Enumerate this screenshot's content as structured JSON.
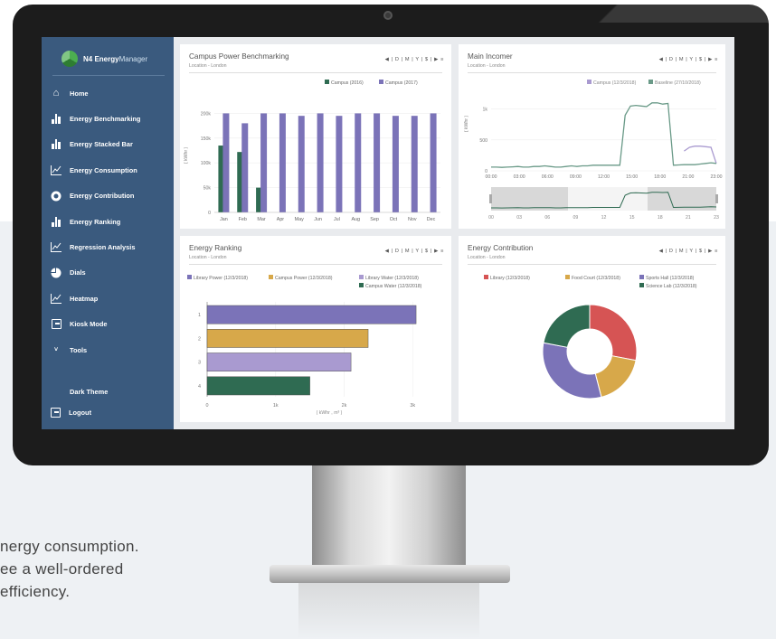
{
  "caption": {
    "line1": "nergy consumption.",
    "line2": "ee a well-ordered",
    "line3": " efficiency."
  },
  "app": {
    "brand_bold": "N4 Energy",
    "brand_light": "Manager"
  },
  "sidebar": {
    "items": [
      {
        "label": "Home",
        "icon": "home-icon"
      },
      {
        "label": "Energy Benchmarking",
        "icon": "bar-chart-icon"
      },
      {
        "label": "Energy Stacked Bar",
        "icon": "bar-chart-icon"
      },
      {
        "label": "Energy Consumption",
        "icon": "line-chart-icon"
      },
      {
        "label": "Energy Contribution",
        "icon": "donut-icon"
      },
      {
        "label": "Energy Ranking",
        "icon": "bar-chart-icon"
      },
      {
        "label": "Regression Analysis",
        "icon": "line-chart-icon"
      },
      {
        "label": "Dials",
        "icon": "pie-icon"
      },
      {
        "label": "Heatmap",
        "icon": "line-chart-icon"
      },
      {
        "label": "Kiosk Mode",
        "icon": "kiosk-icon"
      },
      {
        "label": "Tools",
        "icon": "chevron-down-icon"
      }
    ],
    "theme_label": "Dark Theme",
    "logout_label": "Logout"
  },
  "controls": "◀ | D | M | Y | $ | ▶  ≡",
  "colors": {
    "sidebar": "#3a5a7e",
    "purple": "#7b73b8",
    "green": "#2f6b52",
    "gold": "#d7a84a",
    "red": "#d65454",
    "lavender": "#a99ad0"
  },
  "panels": {
    "benchmark": {
      "title": "Campus Power Benchmarking",
      "subtitle": "Location - London"
    },
    "incomer": {
      "title": "Main Incomer",
      "subtitle": "Location - London"
    },
    "ranking": {
      "title": "Energy Ranking",
      "subtitle": "Location - London"
    },
    "contribution": {
      "title": "Energy Contribution",
      "subtitle": "Location - London"
    }
  },
  "chart_data": [
    {
      "id": "benchmark",
      "type": "bar",
      "title": "Campus Power Benchmarking",
      "ylabel": "( kWhr )",
      "categories": [
        "Jan",
        "Feb",
        "Mar",
        "Apr",
        "May",
        "Jun",
        "Jul",
        "Aug",
        "Sep",
        "Oct",
        "Nov",
        "Dec"
      ],
      "yticks": [
        "0",
        "50k",
        "100k",
        "150k",
        "200k"
      ],
      "ylim": [
        0,
        230000
      ],
      "series": [
        {
          "name": "Campus (2016)",
          "color": "#2f6b52",
          "values": [
            135000,
            122000,
            50000,
            null,
            null,
            null,
            null,
            null,
            null,
            null,
            null,
            null
          ]
        },
        {
          "name": "Campus (2017)",
          "color": "#7b73b8",
          "values": [
            200000,
            180000,
            200000,
            200000,
            195000,
            200000,
            195000,
            200000,
            200000,
            195000,
            195000,
            200000
          ]
        }
      ]
    },
    {
      "id": "incomer",
      "type": "line",
      "title": "Main Incomer",
      "ylabel": "( kWhr )",
      "x": [
        "00:00",
        "03:00",
        "06:00",
        "09:00",
        "12:00",
        "15:00",
        "18:00",
        "21:00",
        "23:00"
      ],
      "yticks": [
        "0",
        "500",
        "1k"
      ],
      "ylim": [
        0,
        1200
      ],
      "series": [
        {
          "name": "Campus (12/3/2018)",
          "color": "#a99ad0",
          "values": [
            0,
            0,
            0,
            0,
            0,
            0,
            0,
            0,
            0,
            0,
            0,
            0,
            0,
            0,
            0,
            0,
            0,
            0,
            0,
            0,
            0,
            0,
            0,
            0,
            0,
            0,
            0,
            0,
            0,
            0,
            0,
            0,
            0,
            0,
            0,
            0,
            320,
            380,
            400,
            400,
            390,
            380,
            120
          ]
        },
        {
          "name": "Baseline (27/10/2018)",
          "color": "#6a9a88",
          "values": [
            60,
            60,
            55,
            60,
            65,
            70,
            60,
            60,
            70,
            70,
            80,
            70,
            60,
            60,
            70,
            80,
            70,
            80,
            80,
            90,
            90,
            90,
            90,
            90,
            90,
            900,
            1050,
            1060,
            1050,
            1040,
            1100,
            1100,
            1080,
            1090,
            90,
            95,
            100,
            100,
            100,
            110,
            120,
            130,
            120
          ]
        }
      ],
      "navigator_x": [
        "00",
        "03",
        "06",
        "09",
        "12",
        "15",
        "18",
        "21",
        "23"
      ]
    },
    {
      "id": "ranking",
      "type": "bar",
      "orientation": "horizontal",
      "title": "Energy Ranking",
      "xlabel": "( kWhr , m³ )",
      "categories": [
        "1",
        "2",
        "3",
        "4"
      ],
      "xticks": [
        "0",
        "1k",
        "2k",
        "3k"
      ],
      "xlim": [
        0,
        3300
      ],
      "series": [
        {
          "name": "Library Power (12/3/2018)",
          "color": "#7b73b8",
          "value": 3050
        },
        {
          "name": "Campus Power (12/3/2018)",
          "color": "#d7a84a",
          "value": 2350
        },
        {
          "name": "Library Water (12/3/2018)",
          "color": "#a99ad0",
          "value": 2100
        },
        {
          "name": "Campus Water (12/3/2018)",
          "color": "#2f6b52",
          "value": 1500
        }
      ]
    },
    {
      "id": "contribution",
      "type": "pie",
      "title": "Energy Contribution",
      "series": [
        {
          "name": "Library (12/3/2018)",
          "color": "#d65454",
          "value": 28
        },
        {
          "name": "Food Court (12/3/2018)",
          "color": "#d7a84a",
          "value": 18
        },
        {
          "name": "Sports Hall (12/3/2018)",
          "color": "#7b73b8",
          "value": 32
        },
        {
          "name": "Science Lab (12/3/2018)",
          "color": "#2f6b52",
          "value": 22
        }
      ]
    }
  ]
}
